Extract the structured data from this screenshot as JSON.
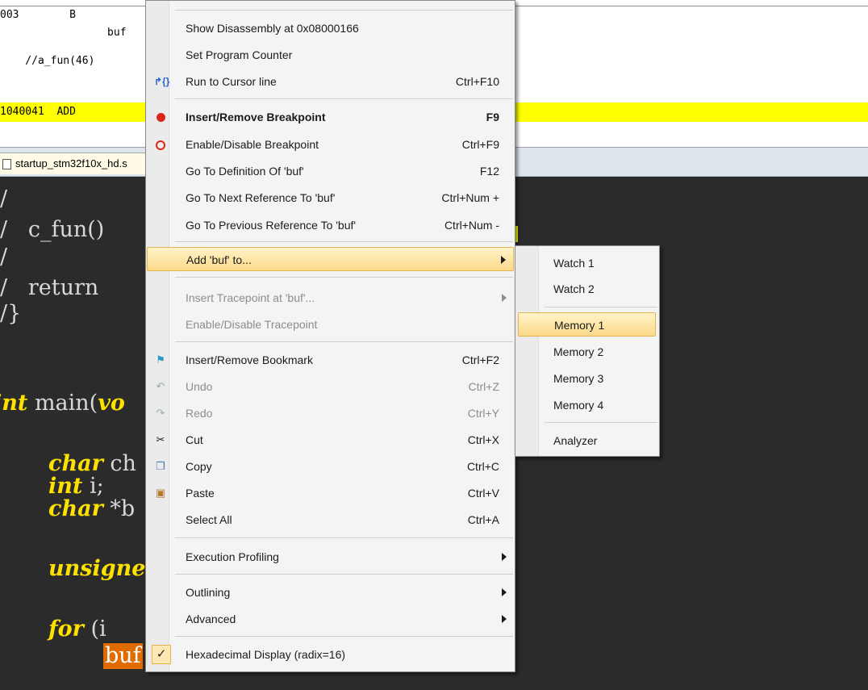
{
  "disassembly": {
    "lines": [
      {
        "text": "003        B"
      },
      {
        "text": "                 buf"
      },
      {
        "text": "    //a_fun(46)"
      },
      {
        "text": "1040041  ADD"
      }
    ]
  },
  "tabs": {
    "active_label": "startup_stm32f10x_hd.s"
  },
  "editor": {
    "lines": [
      "/",
      "/   c_fun()",
      "/",
      "/   return",
      "/}",
      "int main(vo",
      "char ch",
      "int i;",
      "char *b",
      "unsigne",
      "for (i",
      "buf"
    ]
  },
  "context_menu": {
    "items": [
      {
        "label": "Show Disassembly at 0x08000166",
        "shortcut": "",
        "enabled": true
      },
      {
        "label": "Set Program Counter",
        "shortcut": "",
        "enabled": true
      },
      {
        "label": "Run to Cursor line",
        "shortcut": "Ctrl+F10",
        "enabled": true,
        "icon": "run-to-cursor-icon"
      },
      {
        "label": "Insert/Remove Breakpoint",
        "shortcut": "F9",
        "enabled": true,
        "bold": true,
        "icon": "breakpoint-icon"
      },
      {
        "label": "Enable/Disable Breakpoint",
        "shortcut": "Ctrl+F9",
        "enabled": true,
        "icon": "breakpoint-outline-icon"
      },
      {
        "label": "Go To Definition Of 'buf'",
        "shortcut": "F12",
        "enabled": true
      },
      {
        "label": "Go To Next Reference To 'buf'",
        "shortcut": "Ctrl+Num +",
        "enabled": true
      },
      {
        "label": "Go To Previous Reference To 'buf'",
        "shortcut": "Ctrl+Num -",
        "enabled": true
      },
      {
        "label": "Add 'buf' to...",
        "submenu": true,
        "enabled": true,
        "highlighted": true
      },
      {
        "label": "Insert Tracepoint at 'buf'...",
        "submenu": true,
        "enabled": false
      },
      {
        "label": "Enable/Disable Tracepoint",
        "shortcut": "",
        "enabled": false
      },
      {
        "label": "Insert/Remove Bookmark",
        "shortcut": "Ctrl+F2",
        "enabled": true,
        "icon": "bookmark-flag-icon"
      },
      {
        "label": "Undo",
        "shortcut": "Ctrl+Z",
        "enabled": false,
        "icon": "undo-icon"
      },
      {
        "label": "Redo",
        "shortcut": "Ctrl+Y",
        "enabled": false,
        "icon": "redo-icon"
      },
      {
        "label": "Cut",
        "shortcut": "Ctrl+X",
        "enabled": true,
        "icon": "scissors-icon"
      },
      {
        "label": "Copy",
        "shortcut": "Ctrl+C",
        "enabled": true,
        "icon": "copy-icon"
      },
      {
        "label": "Paste",
        "shortcut": "Ctrl+V",
        "enabled": true,
        "icon": "paste-icon"
      },
      {
        "label": "Select All",
        "shortcut": "Ctrl+A",
        "enabled": true
      },
      {
        "label": "Execution Profiling",
        "submenu": true,
        "enabled": true
      },
      {
        "label": "Outlining",
        "submenu": true,
        "enabled": true
      },
      {
        "label": "Advanced",
        "submenu": true,
        "enabled": true
      },
      {
        "label": "Hexadecimal Display (radix=16)",
        "shortcut": "",
        "enabled": true,
        "checked": true,
        "icon": "checkmark-icon"
      }
    ]
  },
  "submenu": {
    "items": [
      {
        "label": "Watch 1"
      },
      {
        "label": "Watch 2"
      },
      {
        "label": "Memory 1",
        "highlighted": true
      },
      {
        "label": "Memory 2"
      },
      {
        "label": "Memory 3"
      },
      {
        "label": "Memory 4"
      },
      {
        "label": "Analyzer"
      }
    ]
  },
  "colors": {
    "editor_bg": "#2b2b2b",
    "keyword": "#ffe100",
    "current_line": "#ffff00",
    "selection": "#e26b00",
    "menu_bg": "#f4f4f4",
    "highlight_border": "#e6b351"
  }
}
